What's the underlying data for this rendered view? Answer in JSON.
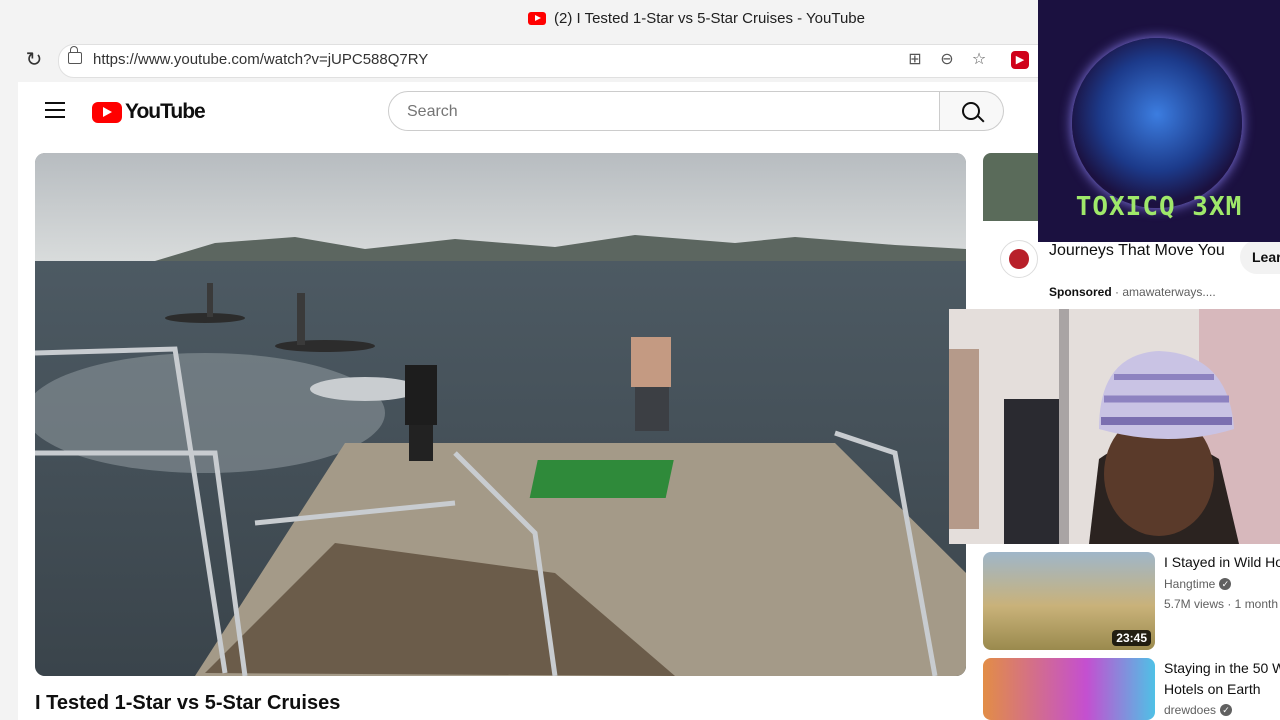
{
  "browser": {
    "tab_title": "(2) I Tested 1-Star vs 5-Star Cruises - YouTube",
    "url": "https://www.youtube.com/watch?v=jUPC588Q7RY"
  },
  "youtube": {
    "logo_text": "YouTube",
    "search_placeholder": "Search"
  },
  "video": {
    "title": "I Tested 1-Star vs 5-Star Cruises"
  },
  "ad": {
    "title": "Journeys That Move You",
    "sponsored_label": "Sponsored",
    "advertiser": "amawaterways....",
    "cta": "Lear"
  },
  "overlay": {
    "brand": "TOXICQ 3XM"
  },
  "recommendations": [
    {
      "title": "I Stayed in Wild Ho",
      "channel": "Hangtime",
      "meta": "5.7M views · 1 month",
      "duration": "23:45"
    },
    {
      "title_line1": "Staying in the 50 W",
      "title_line2": "Hotels on Earth",
      "channel": "drewdoes"
    }
  ]
}
